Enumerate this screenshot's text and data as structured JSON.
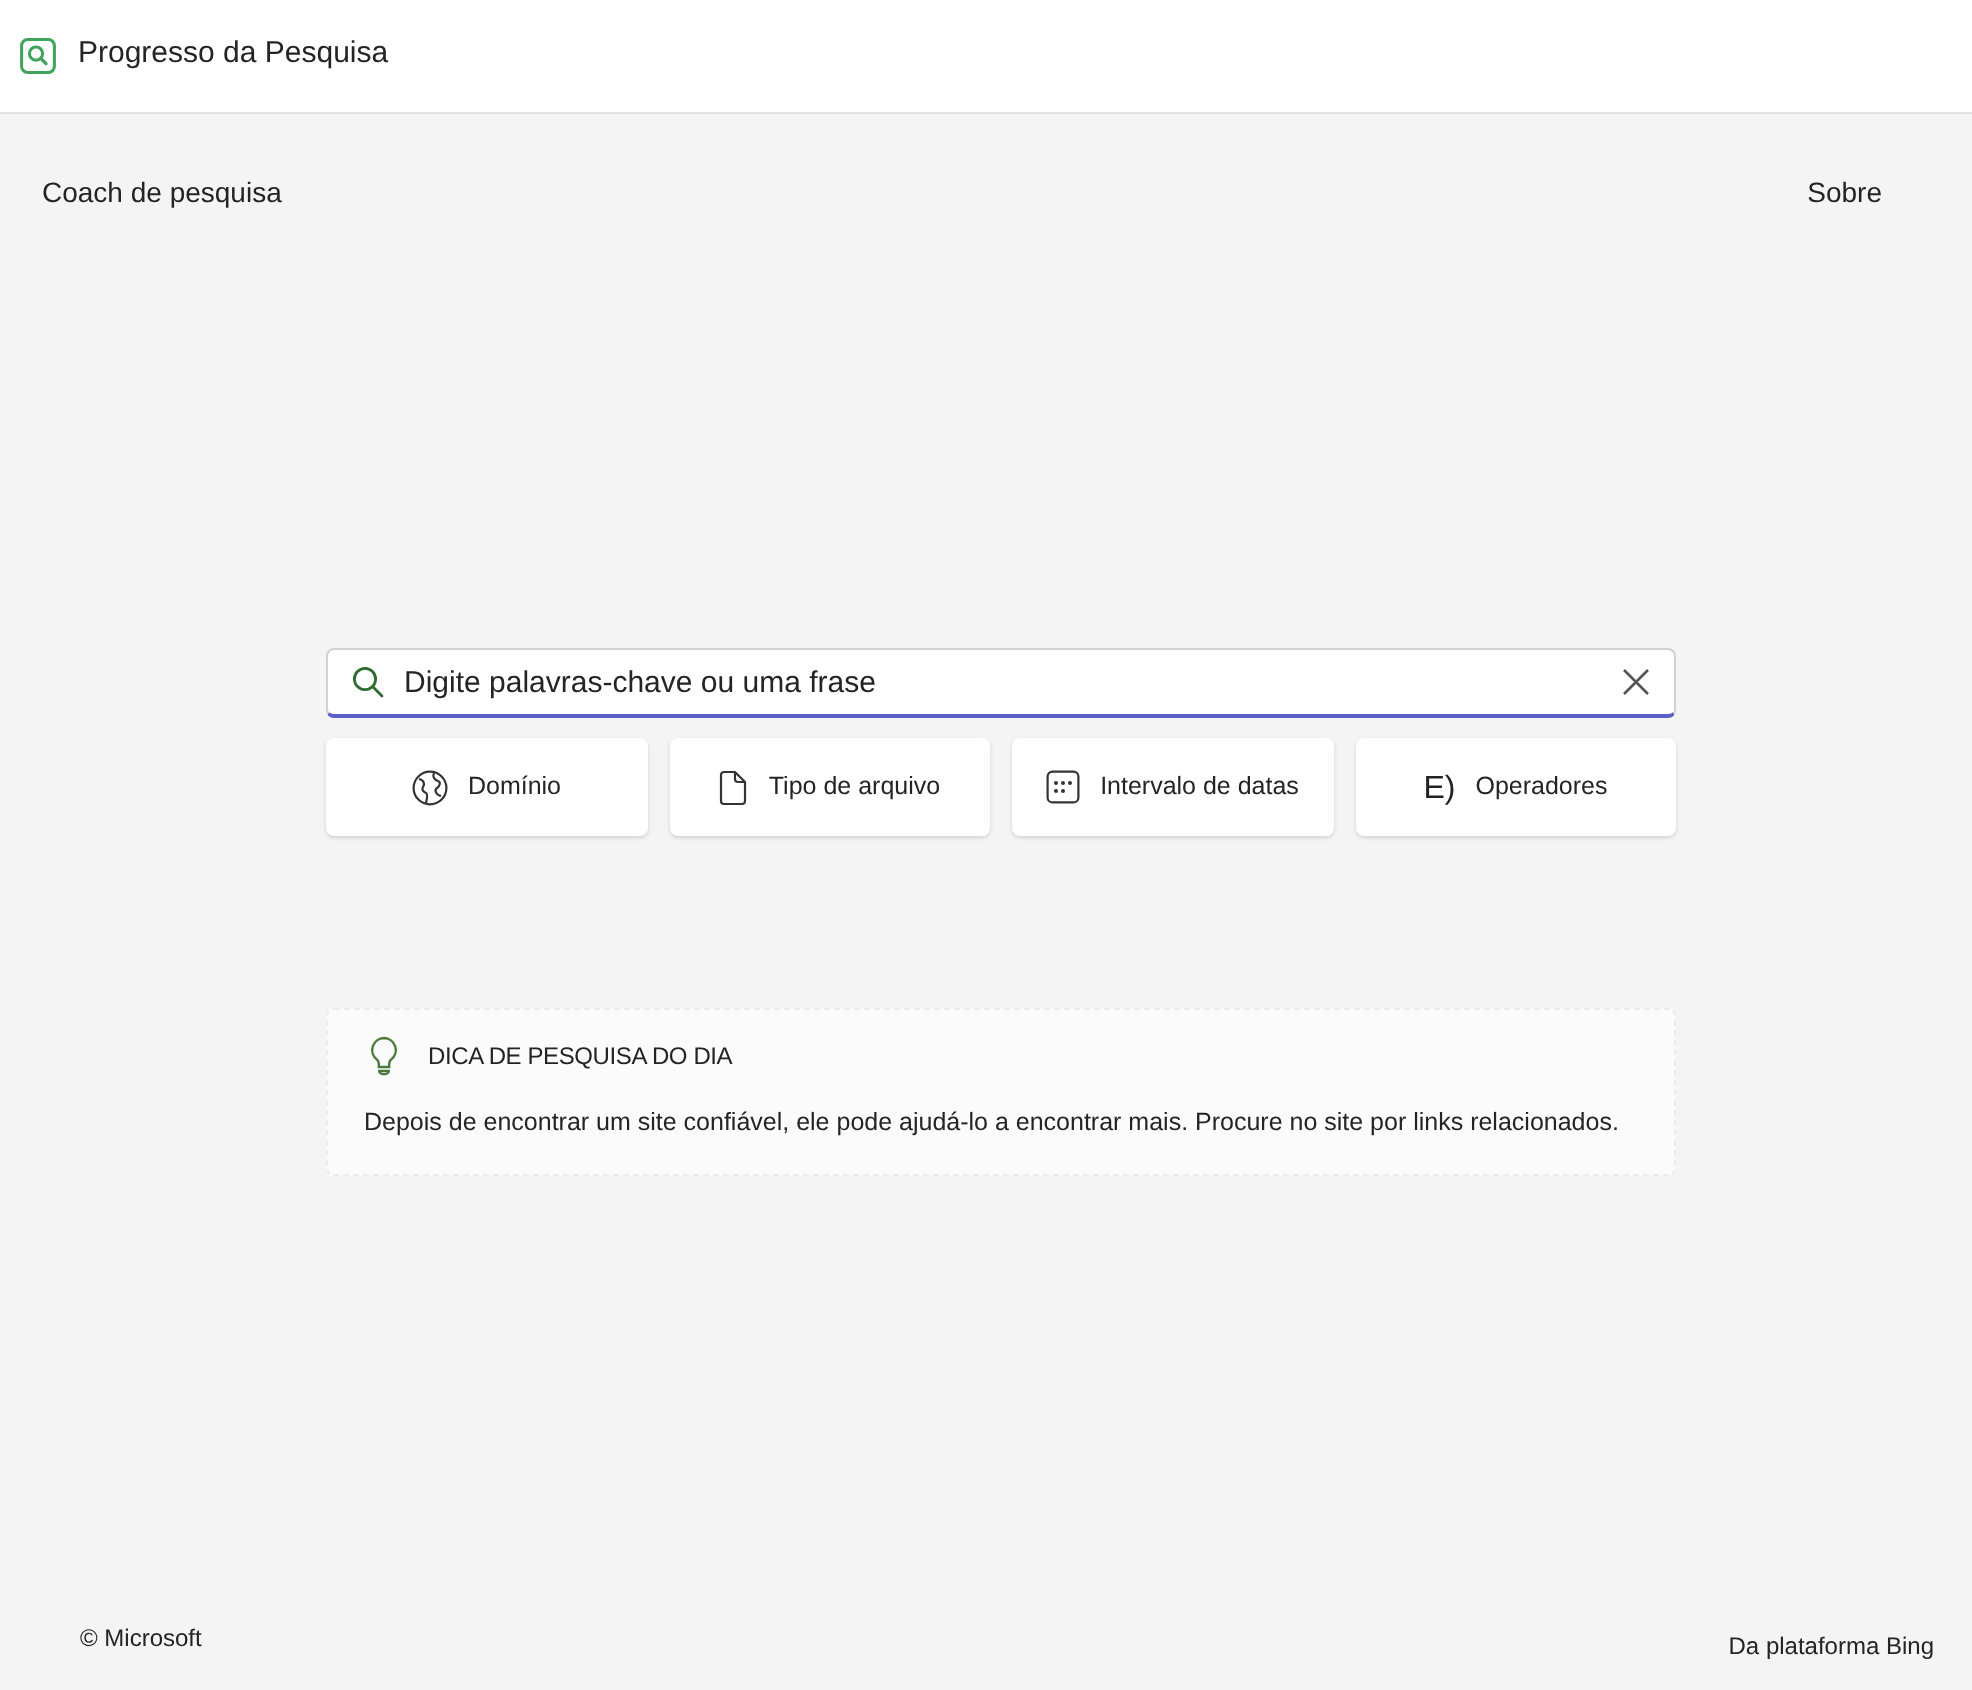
{
  "app_bar": {
    "title": "Progresso da Pesquisa"
  },
  "nav": {
    "left_link": "Coach de pesquisa",
    "right_link": "Sobre"
  },
  "search": {
    "placeholder": "Digite palavras-chave ou uma frase"
  },
  "filters": [
    {
      "kind": "globe",
      "label": "Domínio"
    },
    {
      "kind": "file",
      "label": "Tipo de arquivo"
    },
    {
      "kind": "calendar",
      "label": "Intervalo de datas"
    },
    {
      "kind": "glyph",
      "glyph": "E)",
      "label": "Operadores"
    }
  ],
  "tip": {
    "title": "DICA DE PESQUISA DO DIA",
    "text": "Depois de encontrar um site confiável, ele pode ajudá-lo a encontrar mais. Procure no site por links relacionados."
  },
  "footer": {
    "copyright": "© Microsoft",
    "attribution": "Da plataforma Bing"
  }
}
